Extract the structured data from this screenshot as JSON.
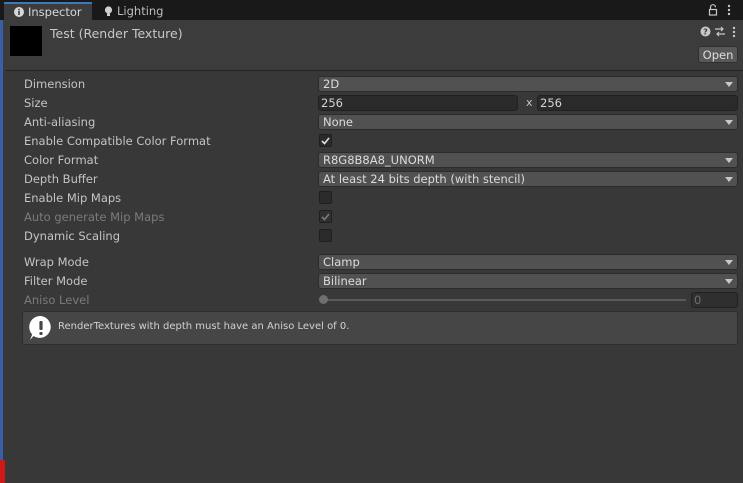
{
  "tabs": [
    {
      "label": "Inspector",
      "icon": "info-icon",
      "active": true
    },
    {
      "label": "Lighting",
      "icon": "bulb-icon",
      "active": false
    }
  ],
  "header": {
    "title": "Test (Render Texture)",
    "open_label": "Open"
  },
  "properties": {
    "dimension": {
      "label": "Dimension",
      "value": "2D"
    },
    "size": {
      "label": "Size",
      "width": "256",
      "separator": "x",
      "height": "256"
    },
    "anti_aliasing": {
      "label": "Anti-aliasing",
      "value": "None"
    },
    "compatible_color": {
      "label": "Enable Compatible Color Format",
      "checked": true
    },
    "color_format": {
      "label": "Color Format",
      "value": "R8G8B8A8_UNORM"
    },
    "depth_buffer": {
      "label": "Depth Buffer",
      "value": "At least 24 bits depth (with stencil)"
    },
    "enable_mipmaps": {
      "label": "Enable Mip Maps",
      "checked": false
    },
    "auto_mipmaps": {
      "label": "Auto generate Mip Maps",
      "checked": true,
      "disabled": true
    },
    "dynamic_scaling": {
      "label": "Dynamic Scaling",
      "checked": false
    },
    "wrap_mode": {
      "label": "Wrap Mode",
      "value": "Clamp"
    },
    "filter_mode": {
      "label": "Filter Mode",
      "value": "Bilinear"
    },
    "aniso_level": {
      "label": "Aniso Level",
      "value": "0",
      "slider_fraction": 0,
      "disabled": true
    }
  },
  "help": {
    "icon": "warning-icon",
    "text": "RenderTextures with depth must have an Aniso Level of 0."
  },
  "colors": {
    "background": "#383838",
    "tab_bar": "#191919",
    "accent": "#3a79bb"
  }
}
